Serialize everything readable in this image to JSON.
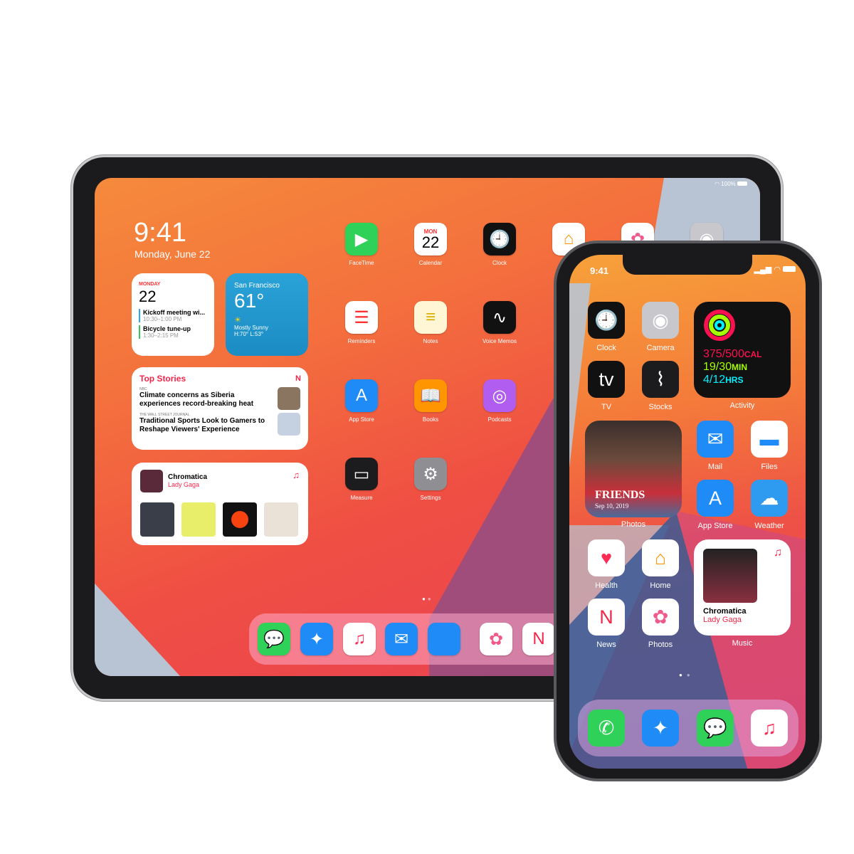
{
  "ipad": {
    "status": {
      "battery": "100%"
    },
    "time": "9:41",
    "date": "Monday, June 22",
    "calendar_widget": {
      "day": "MONDAY",
      "date": "22",
      "events": [
        {
          "title": "Kickoff meeting wi...",
          "time": "10:30–1:00 PM",
          "color": "#2aa8f2"
        },
        {
          "title": "Bicycle tune-up",
          "time": "1:30–2:15 PM",
          "color": "#34c759"
        }
      ]
    },
    "weather_widget": {
      "city": "San Francisco",
      "temp": "61°",
      "condition": "Mostly Sunny",
      "hilo": "H:70° L:53°"
    },
    "news_widget": {
      "title": "Top Stories",
      "stories": [
        {
          "source": "NBC",
          "headline": "Climate concerns as Siberia experiences record-breaking heat"
        },
        {
          "source": "THE WALL STREET JOURNAL",
          "headline": "Traditional Sports Look to Gamers to Reshape Viewers' Experience"
        }
      ]
    },
    "music_widget": {
      "album": "Chromatica",
      "artist": "Lady Gaga"
    },
    "apps": [
      {
        "label": "FaceTime",
        "icon": "video-icon",
        "color": "#30d158"
      },
      {
        "label": "Calendar",
        "icon": "calendar-icon",
        "color": "#ffffff",
        "month": "MON",
        "day": "22"
      },
      {
        "label": "Clock",
        "icon": "clock-icon",
        "color": "#111111"
      },
      {
        "label": "",
        "icon": "home-icon",
        "color": "#ffffff"
      },
      {
        "label": "",
        "icon": "photos-icon",
        "color": "#ffffff"
      },
      {
        "label": "",
        "icon": "camera-icon",
        "color": "#c8c8cc"
      },
      {
        "label": "Reminders",
        "icon": "reminders-icon",
        "color": "#ffffff"
      },
      {
        "label": "Notes",
        "icon": "notes-icon",
        "color": "#fff6d6"
      },
      {
        "label": "Voice Memos",
        "icon": "waveform-icon",
        "color": "#111111"
      },
      {
        "label": "App Store",
        "icon": "appstore-icon",
        "color": "#1e8bf6"
      },
      {
        "label": "Books",
        "icon": "book-icon",
        "color": "#ff9500"
      },
      {
        "label": "Podcasts",
        "icon": "podcast-icon",
        "color": "#b15ef0"
      },
      {
        "label": "Measure",
        "icon": "ruler-icon",
        "color": "#1c1c1e"
      },
      {
        "label": "Settings",
        "icon": "gear-icon",
        "color": "#8e8e93"
      }
    ],
    "dock": [
      {
        "icon": "messages-icon",
        "color": "#30d158"
      },
      {
        "icon": "safari-icon",
        "color": "#1e8bf6"
      },
      {
        "icon": "music-icon",
        "color": "#ffffff"
      },
      {
        "icon": "mail-icon",
        "color": "#1e8bf6"
      },
      {
        "icon": "files-icon",
        "color": "#1e8bf6"
      },
      {
        "icon": "photos-icon",
        "color": "#ffffff"
      },
      {
        "icon": "news-icon",
        "color": "#ffffff"
      }
    ]
  },
  "iphone": {
    "status": {
      "time": "9:41"
    },
    "apps": [
      {
        "label": "Clock",
        "icon": "clock-icon",
        "color": "#111111"
      },
      {
        "label": "Camera",
        "icon": "camera-icon",
        "color": "#c8c8cc"
      },
      {
        "label": "TV",
        "icon": "tv-icon",
        "color": "#111111",
        "text": "tv"
      },
      {
        "label": "Stocks",
        "icon": "stocks-icon",
        "color": "#1c1c1e"
      },
      {
        "label": "Mail",
        "icon": "mail-icon",
        "color": "#1e8bf6"
      },
      {
        "label": "Files",
        "icon": "files-icon",
        "color": "#ffffff"
      },
      {
        "label": "App Store",
        "icon": "appstore-icon",
        "color": "#1e8bf6"
      },
      {
        "label": "Weather",
        "icon": "weather-icon",
        "color": "#2f9bf0"
      },
      {
        "label": "Health",
        "icon": "heart-icon",
        "color": "#ffffff"
      },
      {
        "label": "Home",
        "icon": "home-icon",
        "color": "#ffffff"
      },
      {
        "label": "News",
        "icon": "news-icon",
        "color": "#ffffff"
      },
      {
        "label": "Photos",
        "icon": "photos-icon",
        "color": "#ffffff"
      }
    ],
    "activity_widget": {
      "label": "Activity",
      "move": "375/500",
      "move_unit": "CAL",
      "exercise": "19/30",
      "exercise_unit": "MIN",
      "stand": "4/12",
      "stand_unit": "HRS",
      "colors": {
        "move": "#fa114f",
        "exercise": "#a6ff00",
        "stand": "#00f0ff"
      }
    },
    "photos_widget": {
      "label": "Photos",
      "caption": "FRIENDS",
      "date": "Sep 10, 2019"
    },
    "music_widget": {
      "label": "Music",
      "album": "Chromatica",
      "artist": "Lady Gaga"
    },
    "dock": [
      {
        "icon": "phone-icon",
        "color": "#30d158"
      },
      {
        "icon": "safari-icon",
        "color": "#1e8bf6"
      },
      {
        "icon": "messages-icon",
        "color": "#30d158"
      },
      {
        "icon": "music-icon",
        "color": "#ffffff"
      }
    ]
  }
}
